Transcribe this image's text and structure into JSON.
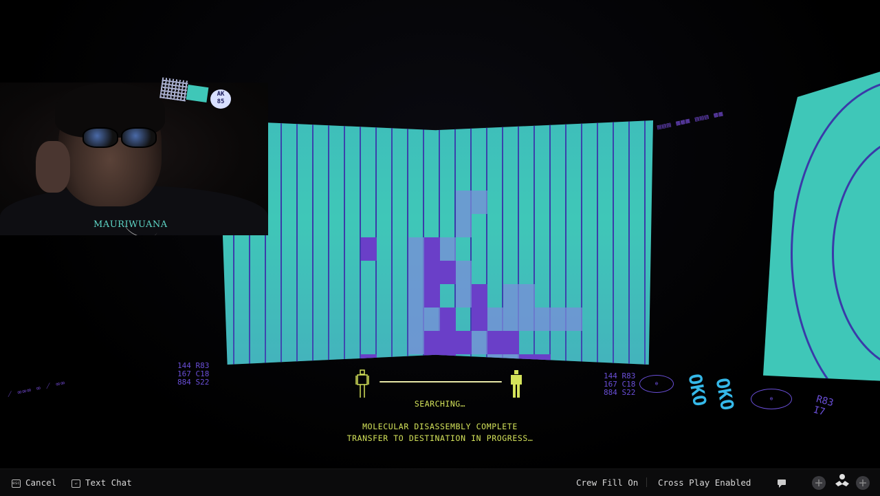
{
  "stream_overlay": {
    "streamer_name": "MAURIWUANA",
    "badge_text": "AK\n85"
  },
  "hud": {
    "search_status": "SEARCHING…",
    "status_line_1": "MOLECULAR DISASSEMBLY COMPLETE",
    "status_line_2": "TRANSFER TO DESTINATION IN PROGRESS…",
    "left_readout": [
      "144  R83",
      "167  C18",
      "884  S22"
    ],
    "right_readout": [
      "144  R83",
      "167  C18",
      "884  S22"
    ],
    "oko_labels": [
      "OKO",
      "OKO"
    ],
    "far_right_readout": [
      "R83",
      "I7"
    ]
  },
  "bottom_bar": {
    "cancel_label": "Cancel",
    "text_chat_label": "Text Chat",
    "crew_fill_label": "Crew Fill On",
    "cross_play_label": "Cross Play Enabled"
  },
  "colors": {
    "teal_screen": "#3fc7b8",
    "grid_purple": "#3a3aa8",
    "hud_yellow": "#d4e35a",
    "readout_purple": "#6a4fd8"
  },
  "icons": [
    "keyboard-key-icon",
    "chat-key-icon",
    "chat-bubble-icon",
    "add-player-icon",
    "crew-icon",
    "add-icon"
  ]
}
